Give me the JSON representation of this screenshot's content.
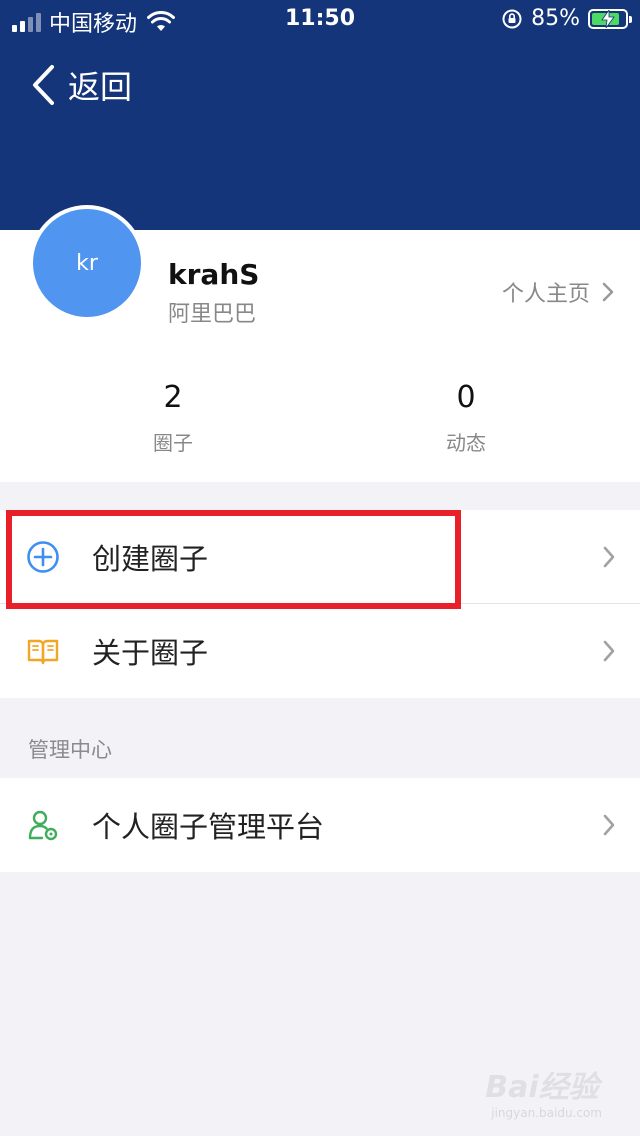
{
  "status_bar": {
    "carrier": "中国移动",
    "time": "11:50",
    "battery": "85%",
    "battery_level": 0.85
  },
  "nav": {
    "back_label": "返回"
  },
  "profile": {
    "avatar_text": "kr",
    "username": "krahS",
    "company": "阿里巴巴",
    "homepage_label": "个人主页",
    "stats": [
      {
        "value": "2",
        "label": "圈子"
      },
      {
        "value": "0",
        "label": "动态"
      }
    ]
  },
  "menu": {
    "create_circle": "创建圈子",
    "about_circle": "关于圈子"
  },
  "management": {
    "section_title": "管理中心",
    "platform_label": "个人圈子管理平台"
  },
  "watermark": {
    "main": "Bai经验",
    "sub": "jingyan.baidu.com"
  },
  "colors": {
    "header_bg": "#14357a",
    "avatar_bg": "#5095ef",
    "highlight_border": "#e8202a",
    "create_icon": "#3d8ff0",
    "about_icon": "#f2a623",
    "platform_icon": "#3fae5a"
  }
}
